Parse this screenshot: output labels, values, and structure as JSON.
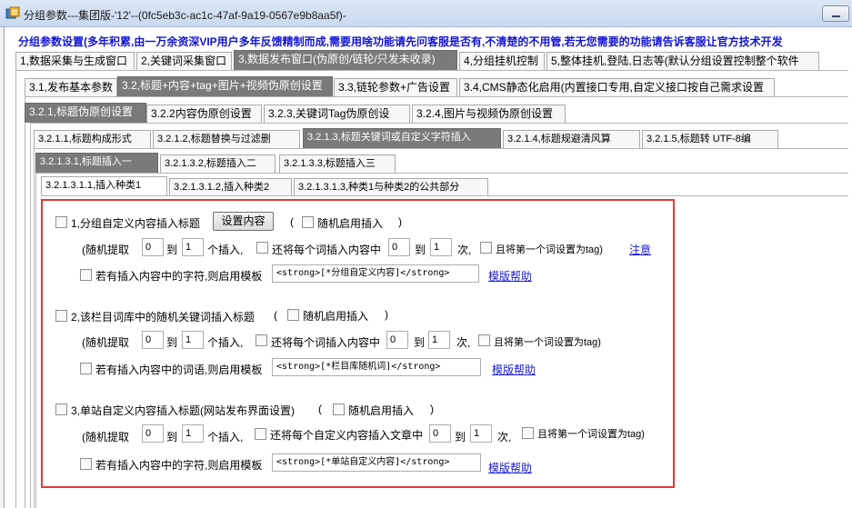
{
  "window": {
    "title": "分组参数---集团版-'12'--(0fc5eb3c-ac1c-47af-9a19-0567e9b8aa5f)-"
  },
  "banner": "分组参数设置(多年积累,由一万余资深VIP用户多年反馈精制而成,需要用啥功能请先问客服是否有,不清楚的不用管,若无您需要的功能请告诉客服让官方技术开发",
  "tabs_l1": [
    "1,数据采集与生成窗口",
    "2,关键词采集窗口",
    "3,数据发布窗口(伪原创/链轮/只发未收录)",
    "4,分组挂机控制",
    "5,整体挂机,登陆,日志等(默认分组设置控制整个软件"
  ],
  "tabs_l2": [
    "3.1,发布基本参数",
    "3.2,标题+内容+tag+图片+视频伪原创设置",
    "3.3,链轮参数+广告设置",
    "3.4,CMS静态化启用(内置接口专用,自定义接口按自己需求设置"
  ],
  "tabs_l3": [
    "3.2.1,标题伪原创设置",
    "3.2.2内容伪原创设置",
    "3.2.3,关键词Tag伪原创设",
    "3.2.4,图片与视频伪原创设置"
  ],
  "tabs_l4": [
    "3.2.1.1,标题构成形式",
    "3.2.1.2,标题替换与过滤删",
    "3.2.1.3,标题关键词或自定义字符插入",
    "3.2.1.4,标题规避清风算",
    "3.2.1.5,标题转 UTF-8编"
  ],
  "tabs_l5": [
    "3.2.1.3.1,标题插入一",
    "3.2.1.3.2,标题插入二",
    "3.2.1.3.3,标题插入三"
  ],
  "tabs_l6": [
    "3.2.1.3.1.1,插入种类1",
    "3.2.1.3.1.2,插入种类2",
    "3.2.1.3.1.3,种类1与种类2的公共部分"
  ],
  "sections": [
    {
      "title": "1,分组自定义内容插入标题",
      "setting_button": "设置内容",
      "open_paren": "(",
      "random_enable": "随机启用插入",
      "close_paren": ")",
      "random_pick": "(随机提取",
      "min": "0",
      "to": "到",
      "max": "1",
      "unit_insert": "个插入,",
      "repeat_label": "还将每个词插入内容中",
      "rep_min": "0",
      "rep_to": "到",
      "rep_max": "1",
      "unit_times": "次,",
      "tag_label": "且将第一个词设置为tag)",
      "note_link": "注意",
      "template_label": "若有插入内容中的字符,则启用模板",
      "template": "<strong>[*分组自定义内容]</strong>",
      "help_link": "模版帮助"
    },
    {
      "title": "2,该栏目词库中的随机关键词插入标题",
      "open_paren": "(",
      "random_enable": "随机启用插入",
      "close_paren": ")",
      "random_pick": "(随机提取",
      "min": "0",
      "to": "到",
      "max": "1",
      "unit_insert": "个插入,",
      "repeat_label": "还将每个词插入内容中",
      "rep_min": "0",
      "rep_to": "到",
      "rep_max": "1",
      "unit_times": "次,",
      "tag_label": "且将第一个词设置为tag)",
      "template_label": "若有插入内容中的词语,则启用模板",
      "template": "<strong>[*栏目库随机词]</strong>",
      "help_link": "模版帮助"
    },
    {
      "title": "3,单站自定义内容插入标题(网站发布界面设置)",
      "open_paren": "(",
      "random_enable": "随机启用插入",
      "close_paren": ")",
      "random_pick": "(随机提取",
      "min": "0",
      "to": "到",
      "max": "1",
      "unit_insert": "个插入,",
      "repeat_label": "还将每个自定义内容插入文章中",
      "rep_min": "0",
      "rep_to": "到",
      "rep_max": "1",
      "unit_times": "次,",
      "tag_label": "且将第一个词设置为tag)",
      "template_label": "若有插入内容中的字符,则启用模板",
      "template": "<strong>[*单站自定义内容]</strong>",
      "help_link": "模版帮助"
    }
  ],
  "colors": {
    "banner": "#1414d2",
    "highlight": "#e53935",
    "active_tab": "#7a7a7a",
    "link": "#1a1ad6"
  },
  "icons": [
    "app-icon",
    "minimize-icon"
  ]
}
